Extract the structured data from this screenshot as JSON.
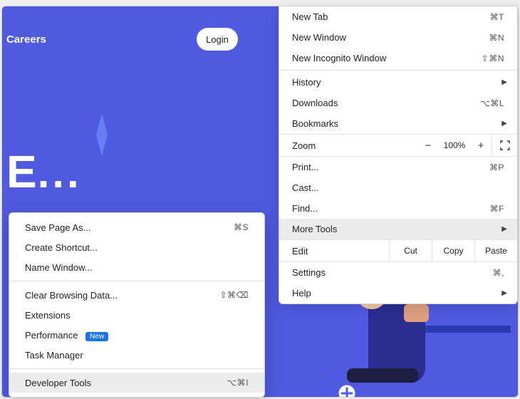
{
  "page": {
    "nav_careers": "Careers",
    "login": "Login",
    "hero_fragment": "E",
    "hero_dots": "..."
  },
  "main_menu": {
    "new_tab": {
      "label": "New Tab",
      "shortcut": "⌘T"
    },
    "new_window": {
      "label": "New Window",
      "shortcut": "⌘N"
    },
    "new_incognito": {
      "label": "New Incognito Window",
      "shortcut": "⇧⌘N"
    },
    "history": {
      "label": "History"
    },
    "downloads": {
      "label": "Downloads",
      "shortcut": "⌥⌘L"
    },
    "bookmarks": {
      "label": "Bookmarks"
    },
    "zoom": {
      "label": "Zoom",
      "minus": "−",
      "pct": "100%",
      "plus": "+"
    },
    "print": {
      "label": "Print...",
      "shortcut": "⌘P"
    },
    "cast": {
      "label": "Cast..."
    },
    "find": {
      "label": "Find...",
      "shortcut": "⌘F"
    },
    "more_tools": {
      "label": "More Tools"
    },
    "edit": {
      "label": "Edit",
      "cut": "Cut",
      "copy": "Copy",
      "paste": "Paste"
    },
    "settings": {
      "label": "Settings",
      "shortcut": "⌘,"
    },
    "help": {
      "label": "Help"
    }
  },
  "more_tools_menu": {
    "save_page": {
      "label": "Save Page As...",
      "shortcut": "⌘S"
    },
    "create_shortcut": {
      "label": "Create Shortcut..."
    },
    "name_window": {
      "label": "Name Window..."
    },
    "clear_browsing": {
      "label": "Clear Browsing Data...",
      "shortcut": "⇧⌘⌫"
    },
    "extensions": {
      "label": "Extensions"
    },
    "performance": {
      "label": "Performance",
      "badge": "New"
    },
    "task_manager": {
      "label": "Task Manager"
    },
    "developer_tools": {
      "label": "Developer Tools",
      "shortcut": "⌥⌘I"
    }
  }
}
